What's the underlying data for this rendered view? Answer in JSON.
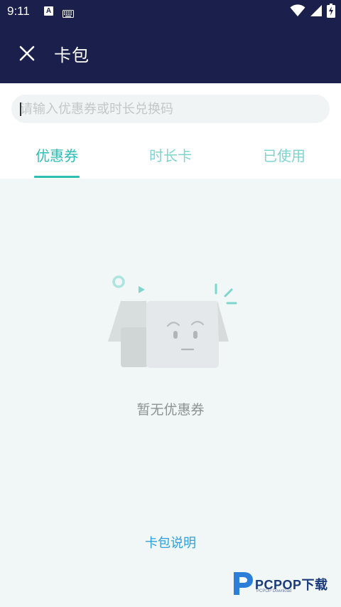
{
  "status_bar": {
    "time": "9:11",
    "badge": "A",
    "icons": [
      "keyboard-icon",
      "wifi-icon",
      "signal-icon",
      "battery-charging-icon"
    ]
  },
  "header": {
    "title": "卡包",
    "close_icon": "close-icon"
  },
  "search": {
    "placeholder": "请输入优惠券或时长兑换码",
    "value": ""
  },
  "tabs": [
    {
      "label": "优惠券",
      "active": true
    },
    {
      "label": "时长卡",
      "active": false
    },
    {
      "label": "已使用",
      "active": false
    }
  ],
  "empty_state": {
    "illustration": "empty-box-face-icon",
    "message": "暂无优惠券"
  },
  "footer": {
    "link": "卡包说明"
  },
  "watermark": {
    "brand": "PCPOP下载",
    "sub": "PCPOP Download"
  },
  "colors": {
    "header_bg": "#1b1f4b",
    "accent": "#2ebdb3",
    "tab_inactive": "#7fd4cd",
    "page_bg": "#f1f6f6",
    "link": "#2ea0dc"
  }
}
